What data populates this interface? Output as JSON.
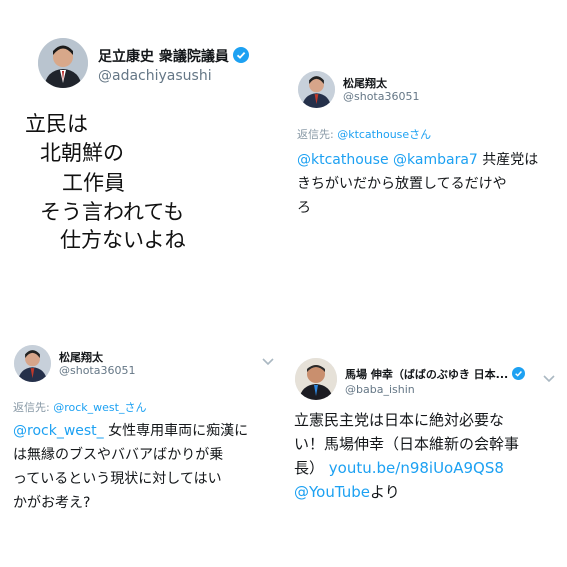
{
  "tweet1": {
    "name": "足立康史 衆議院議員",
    "handle": "@adachiyasushi",
    "verified_icon": "verified-badge-icon",
    "lines": [
      "立民は",
      "北朝鮮の",
      "工作員",
      "そう言われても",
      "仕方ないよね"
    ]
  },
  "tweet2": {
    "name": "松尾翔太",
    "handle": "@shota36051",
    "reply_prefix": "返信先: ",
    "reply_to": "@ktcathouseさん",
    "mention1": "@ktcathouse",
    "mention2": "@kambara7",
    "text_a": " 共産党は",
    "text_b": "きちがいだから放置してるだけや",
    "text_c": "ろ"
  },
  "tweet3": {
    "name": "松尾翔太",
    "handle": "@shota36051",
    "reply_prefix": "返信先: ",
    "reply_to": "@rock_west_さん",
    "mention": "@rock_west_",
    "text_a": " 女性専用車両に痴漢に",
    "text_b": "は無縁のブスやババアばかりが乗",
    "text_c": "っているという現状に対してはい",
    "text_d": "かがお考え?",
    "menu_icon": "chevron-down-icon"
  },
  "tweet4": {
    "name": "馬場 伸幸（ばばのぶゆき 日本...",
    "handle": "@baba_ishin",
    "verified_icon": "verified-badge-icon",
    "text_a": "立憲民主党は日本に絶対必要な",
    "text_b": "い！馬場伸幸（日本維新の会幹事",
    "text_c": "長）",
    "link": "youtu.be/n98iUoA9QS8",
    "mention": "@YouTube",
    "text_d": "より",
    "menu_icon": "chevron-down-icon"
  },
  "colors": {
    "link": "#1da1f2",
    "handle": "#657786",
    "verified": "#1da1f2"
  }
}
